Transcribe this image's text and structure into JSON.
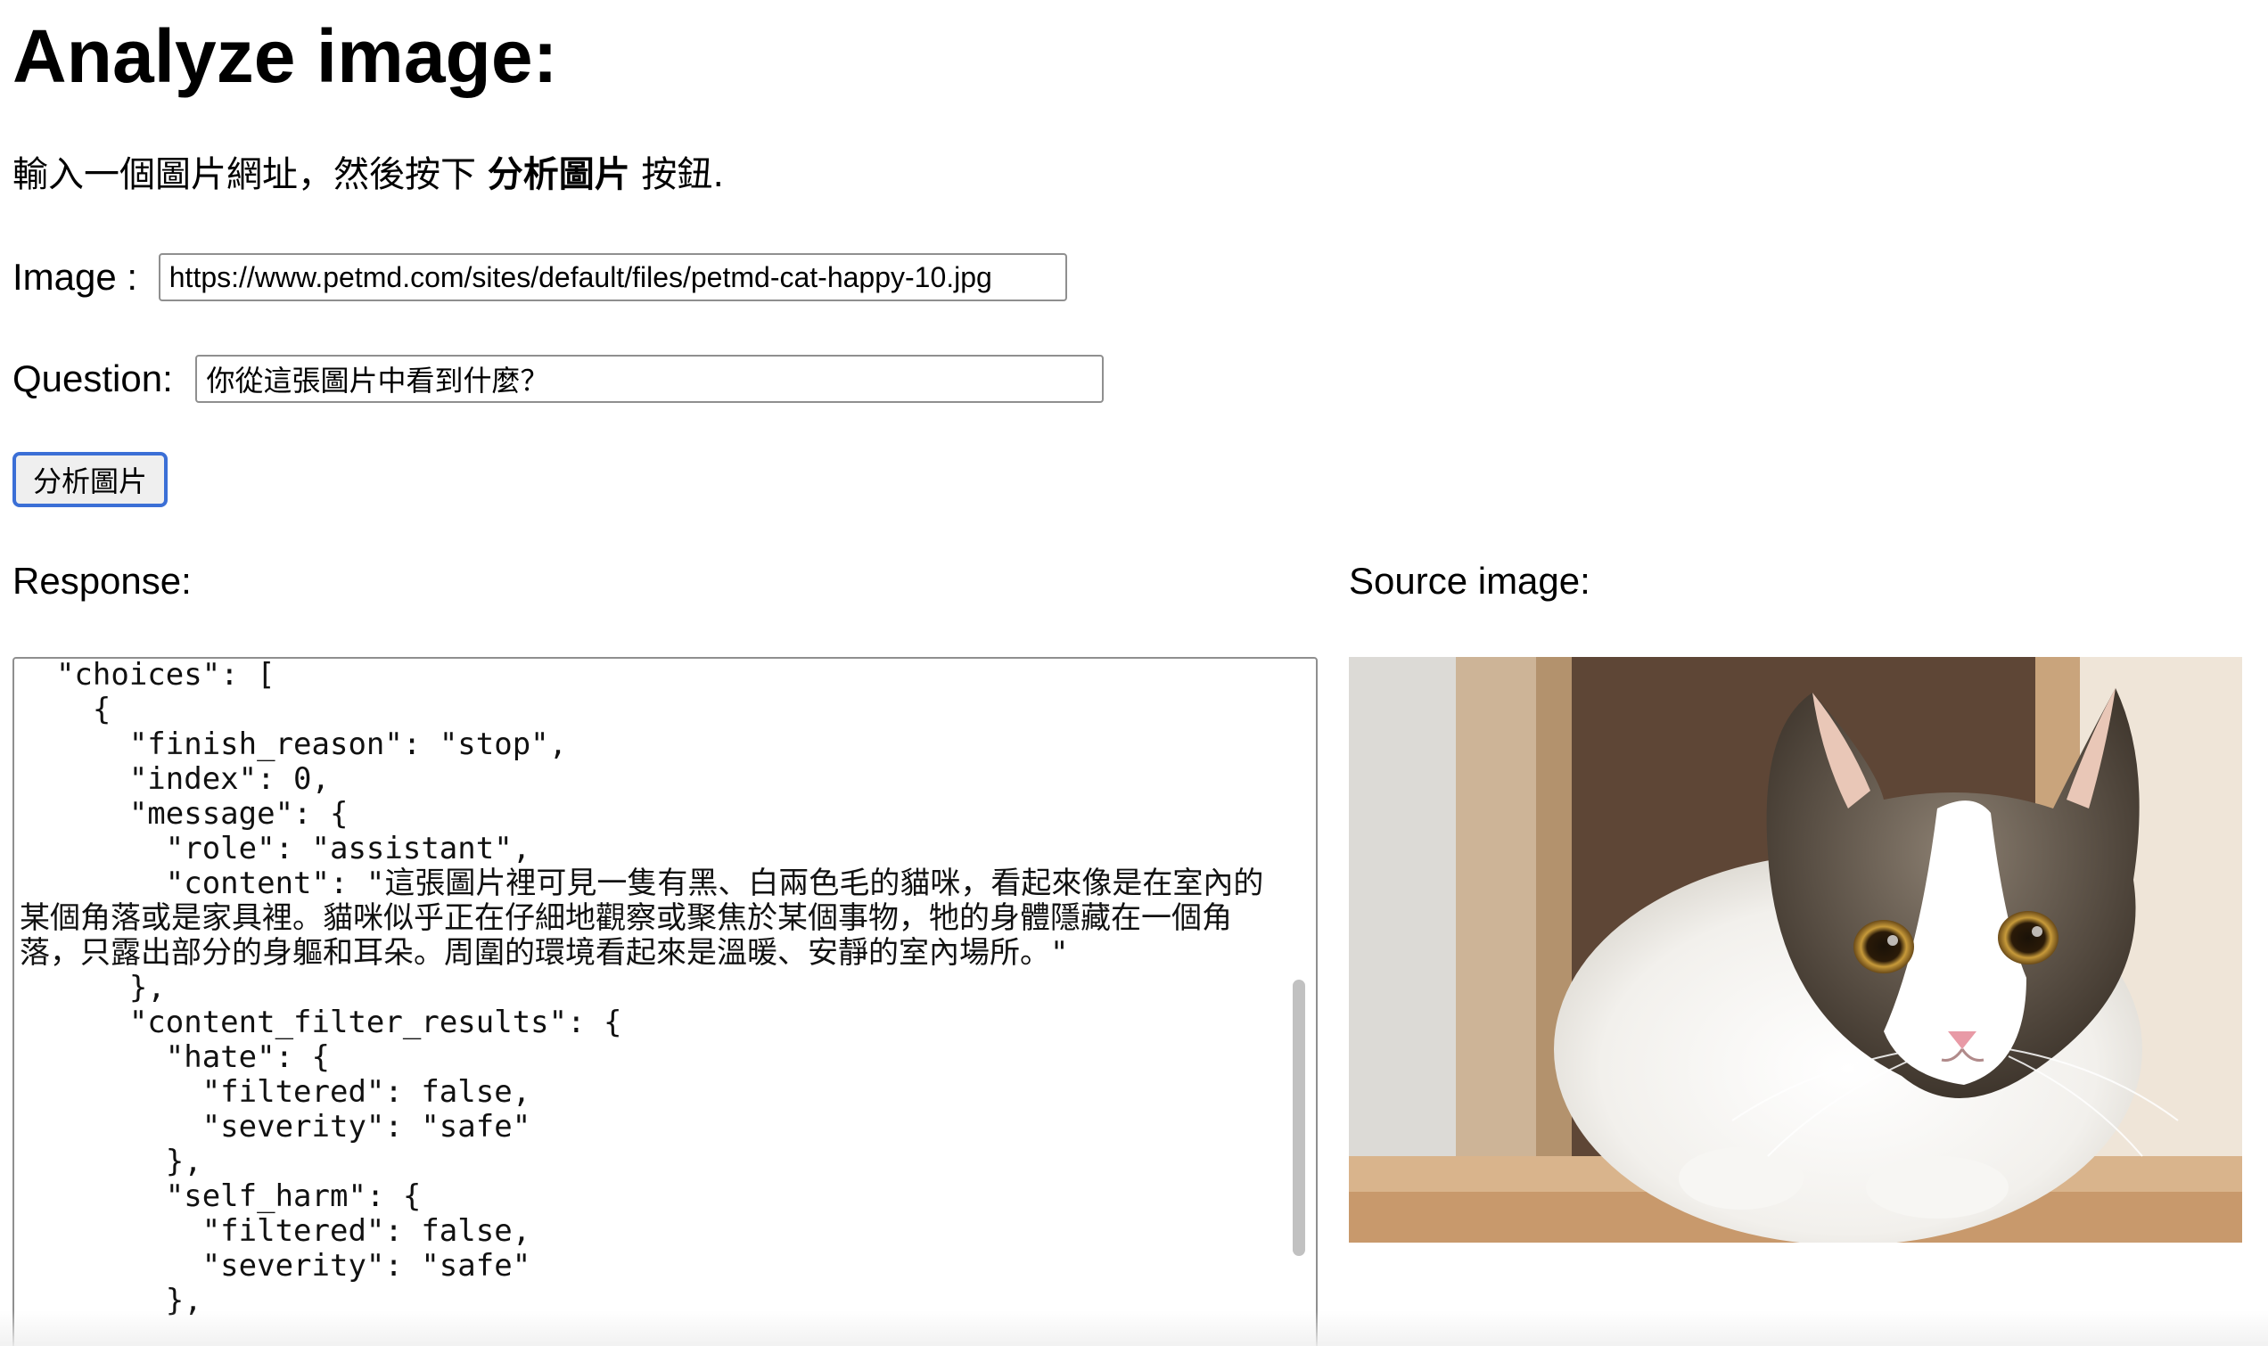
{
  "title": "Analyze image:",
  "instructions": {
    "prefix": "輸入一個圖片網址，然後按下 ",
    "bold": "分析圖片",
    "suffix": " 按鈕."
  },
  "image_field": {
    "label": "Image : ",
    "value": "https://www.petmd.com/sites/default/files/petmd-cat-happy-10.jpg"
  },
  "question_field": {
    "label": "Question: ",
    "value": "你從這張圖片中看到什麼？"
  },
  "analyze_button": {
    "label": "分析圖片"
  },
  "response": {
    "label": "Response:",
    "text": "  },\n  \"choices\": [\n    {\n      \"finish_reason\": \"stop\",\n      \"index\": 0,\n      \"message\": {\n        \"role\": \"assistant\",\n        \"content\": \"這張圖片裡可見一隻有黑、白兩色毛的貓咪，看起來像是在室內的某個角落或是家具裡。貓咪似乎正在仔細地觀察或聚焦於某個事物，牠的身體隱藏在一個角落，只露出部分的身軀和耳朵。周圍的環境看起來是溫暖、安靜的室內場所。\"\n      },\n      \"content_filter_results\": {\n        \"hate\": {\n          \"filtered\": false,\n          \"severity\": \"safe\"\n        },\n        \"self_harm\": {\n          \"filtered\": false,\n          \"severity\": \"safe\"\n        },"
  },
  "source_image": {
    "label": "Source image:",
    "subject": "cat-photo"
  },
  "colors": {
    "button_focus_border": "#3b6fd6",
    "input_border": "#8f8f8f",
    "scroll_thumb": "#c1c1c1"
  }
}
